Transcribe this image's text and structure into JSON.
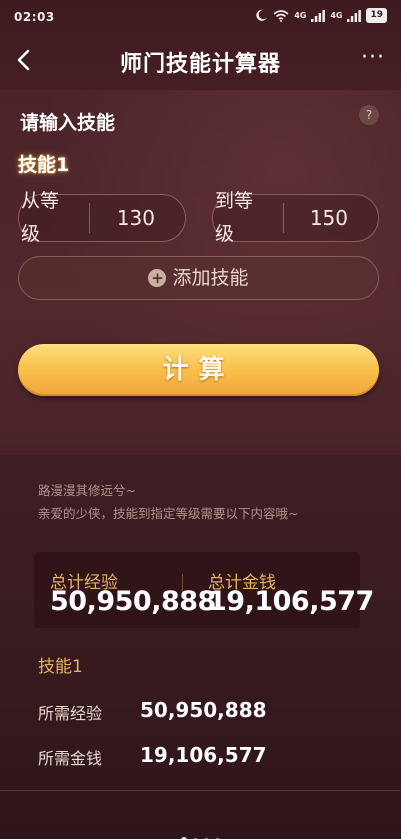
{
  "status_bar": {
    "time": "02:03",
    "signal_1": "4G",
    "signal_2": "4G",
    "battery": "19"
  },
  "nav": {
    "title": "师门技能计算器",
    "more": "···"
  },
  "form": {
    "section_title": "请输入技能",
    "help": "?",
    "skill_label": "技能1",
    "from_label": "从等级",
    "from_value": "130",
    "to_label": "到等级",
    "to_value": "150",
    "add_skill_label": "添加技能",
    "calculate_label": "计算"
  },
  "result": {
    "tagline_1": "路漫漫其修远兮~",
    "tagline_2": "亲爱的少侠，技能到指定等级需要以下内容哦~",
    "total_exp_label": "总计经验",
    "total_exp_value": "50,950,888",
    "total_money_label": "总计金钱",
    "total_money_value": "19,106,577",
    "skill_title": "技能1",
    "req_exp_label": "所需经验",
    "req_exp_value": "50,950,888",
    "req_money_label": "所需金钱",
    "req_money_value": "19,106,577"
  },
  "pagination": {
    "count": 4,
    "active": 0
  },
  "colors": {
    "accent_gold": "#e6b35e",
    "button_orange": "#f9bf4a",
    "background": "#45202a"
  }
}
